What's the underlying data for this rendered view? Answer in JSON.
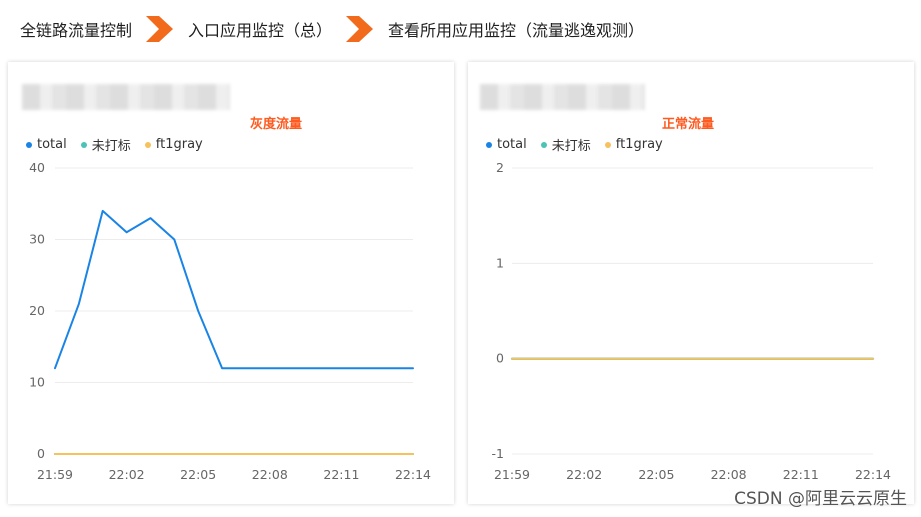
{
  "breadcrumb": {
    "items": [
      "全链路流量控制",
      "入口应用监控（总）",
      "查看所用应用监控（流量逃逸观测）"
    ]
  },
  "colors": {
    "total": "#1a84e6",
    "untagged": "#4cc3b8",
    "ft1gray": "#f5c25c",
    "title": "#ff5a1f",
    "arrow": "#f26a1b"
  },
  "legend": {
    "total": "total",
    "untagged": "未打标",
    "ft1gray": "ft1gray"
  },
  "watermark": "CSDN @阿里云云原生",
  "chart_data": [
    {
      "type": "line",
      "title": "灰度流量",
      "x": [
        "21:59",
        "22:00",
        "22:01",
        "22:02",
        "22:03",
        "22:04",
        "22:05",
        "22:06",
        "22:07",
        "22:08",
        "22:09",
        "22:10",
        "22:11",
        "22:12",
        "22:13",
        "22:14"
      ],
      "xticks": [
        "21:59",
        "22:02",
        "22:05",
        "22:08",
        "22:11",
        "22:14"
      ],
      "yticks": [
        0,
        10,
        20,
        30,
        40
      ],
      "ylim": [
        0,
        40
      ],
      "grid": true,
      "legend_position": "top-left",
      "series": [
        {
          "name": "total",
          "values": [
            12,
            21,
            34,
            31,
            33,
            30,
            20,
            12,
            12,
            12,
            12,
            12,
            12,
            12,
            12,
            12
          ]
        },
        {
          "name": "未打标",
          "values": [
            0,
            0,
            0,
            0,
            0,
            0,
            0,
            0,
            0,
            0,
            0,
            0,
            0,
            0,
            0,
            0
          ]
        },
        {
          "name": "ft1gray",
          "values": [
            0,
            0,
            0,
            0,
            0,
            0,
            0,
            0,
            0,
            0,
            0,
            0,
            0,
            0,
            0,
            0
          ]
        }
      ]
    },
    {
      "type": "line",
      "title": "正常流量",
      "x": [
        "21:59",
        "22:00",
        "22:01",
        "22:02",
        "22:03",
        "22:04",
        "22:05",
        "22:06",
        "22:07",
        "22:08",
        "22:09",
        "22:10",
        "22:11",
        "22:12",
        "22:13",
        "22:14"
      ],
      "xticks": [
        "21:59",
        "22:02",
        "22:05",
        "22:08",
        "22:11",
        "22:14"
      ],
      "yticks": [
        -1,
        0,
        1,
        2
      ],
      "ylim": [
        -1,
        2
      ],
      "grid": true,
      "legend_position": "top-left",
      "series": [
        {
          "name": "total",
          "values": [
            0,
            0,
            0,
            0,
            0,
            0,
            0,
            0,
            0,
            0,
            0,
            0,
            0,
            0,
            0,
            0
          ]
        },
        {
          "name": "未打标",
          "values": [
            0,
            0,
            0,
            0,
            0,
            0,
            0,
            0,
            0,
            0,
            0,
            0,
            0,
            0,
            0,
            0
          ]
        },
        {
          "name": "ft1gray",
          "values": [
            0,
            0,
            0,
            0,
            0,
            0,
            0,
            0,
            0,
            0,
            0,
            0,
            0,
            0,
            0,
            0
          ]
        }
      ]
    }
  ]
}
